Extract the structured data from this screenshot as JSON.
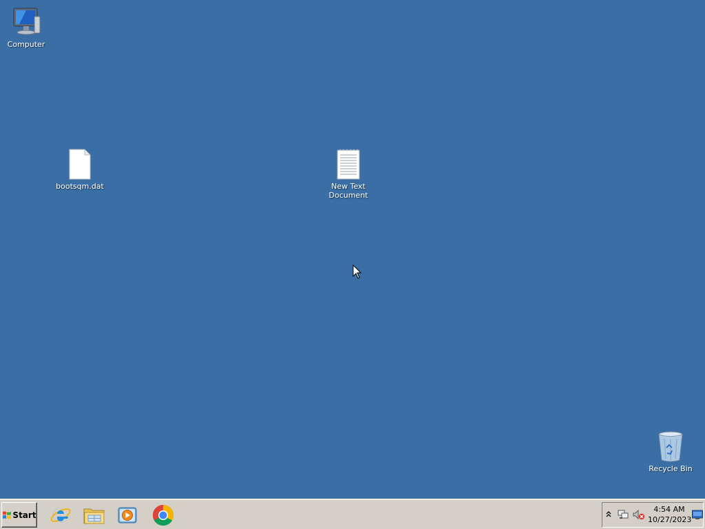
{
  "desktop": {
    "background_color": "#3a6ea5",
    "icons": [
      {
        "label": "Computer",
        "icon": "computer-icon"
      },
      {
        "label": "bootsqm.dat",
        "icon": "blank-file-icon"
      },
      {
        "label": "New Text\nDocument",
        "icon": "text-document-icon"
      },
      {
        "label": "Recycle Bin",
        "icon": "recycle-bin-icon"
      }
    ]
  },
  "taskbar": {
    "start_label": "Start",
    "pinned": [
      {
        "name": "Internet Explorer",
        "icon": "internet-explorer-icon"
      },
      {
        "name": "Windows Explorer",
        "icon": "file-explorer-icon"
      },
      {
        "name": "Windows Media Player",
        "icon": "media-player-icon"
      },
      {
        "name": "Google Chrome",
        "icon": "chrome-icon"
      }
    ],
    "tray": {
      "time": "4:54 AM",
      "date": "10/27/2023"
    }
  }
}
